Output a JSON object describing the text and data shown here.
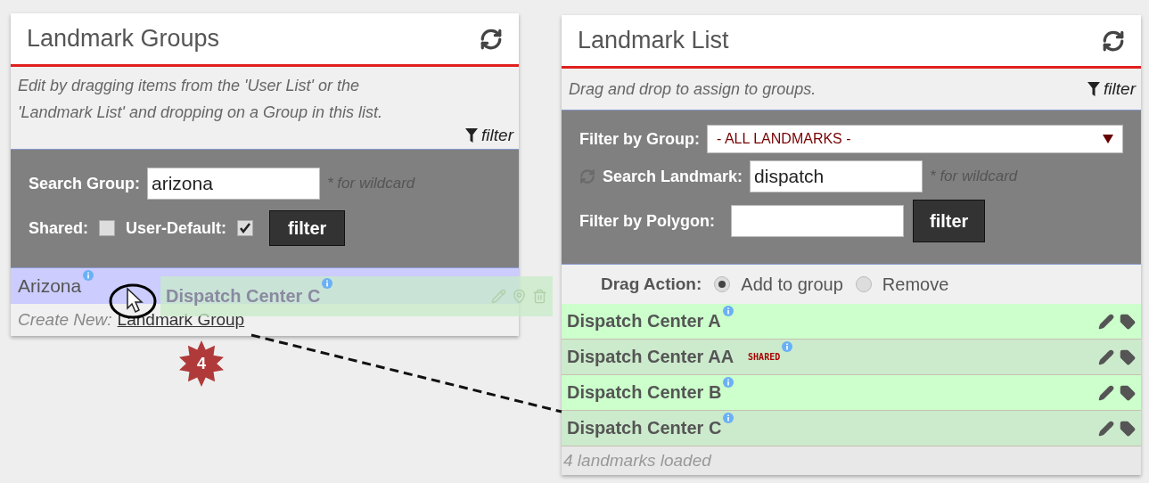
{
  "groups_panel": {
    "title": "Landmark Groups",
    "description": "Edit by dragging items from the 'User List' or the 'Landmark List' and dropping on a Group in this list.",
    "filter_link": "filter",
    "search": {
      "label": "Search Group:",
      "value": "arizona",
      "hint": "* for wildcard"
    },
    "shared": {
      "label": "Shared:",
      "checked": false
    },
    "user_default": {
      "label": "User-Default:",
      "checked": true
    },
    "filter_button": "filter",
    "groups": [
      {
        "name": "Arizona",
        "selected": true
      }
    ],
    "create_new": {
      "label": "Create New:",
      "link": "Landmark Group"
    }
  },
  "drag": {
    "item": "Dispatch Center C",
    "count": "4"
  },
  "list_panel": {
    "title": "Landmark List",
    "description": "Drag and drop to assign to groups.",
    "filter_link": "filter",
    "group_filter": {
      "label": "Filter by Group:",
      "value": "- ALL LANDMARKS -"
    },
    "search": {
      "label": "Search Landmark:",
      "value": "dispatch",
      "hint": "* for wildcard"
    },
    "polygon": {
      "label": "Filter by Polygon:"
    },
    "filter_button": "filter",
    "drag_action": {
      "label": "Drag Action:",
      "options": [
        {
          "label": "Add to group",
          "selected": true
        },
        {
          "label": "Remove",
          "selected": false
        }
      ]
    },
    "landmarks": [
      {
        "name": "Dispatch Center A"
      },
      {
        "name": "Dispatch Center AA",
        "tag": "SHARED"
      },
      {
        "name": "Dispatch Center B"
      },
      {
        "name": "Dispatch Center C"
      }
    ],
    "status": "4 landmarks loaded"
  }
}
